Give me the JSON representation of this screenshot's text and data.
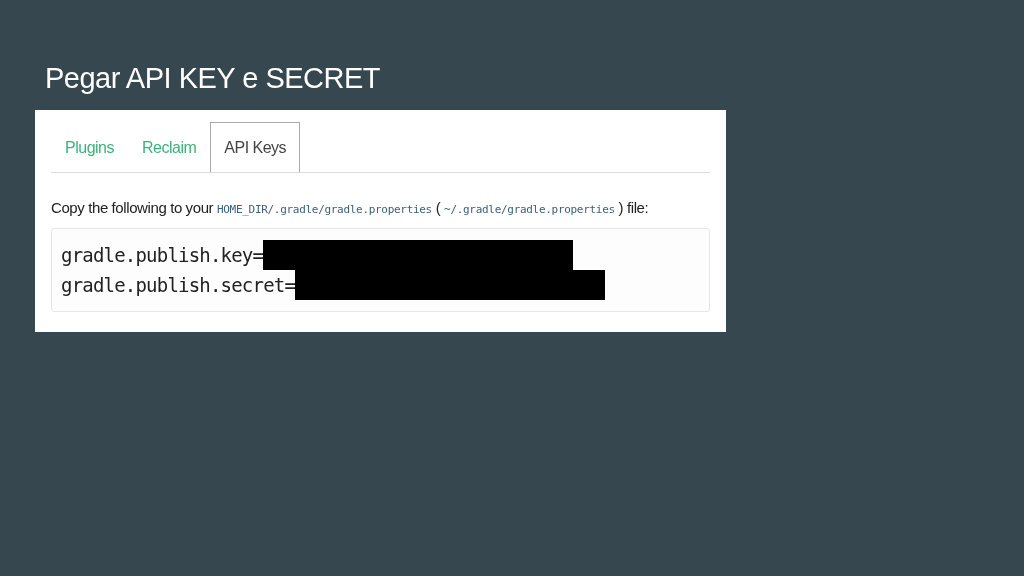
{
  "slide": {
    "title": "Pegar API KEY e SECRET"
  },
  "tabs": [
    {
      "label": "Plugins",
      "selected": false
    },
    {
      "label": "Reclaim",
      "selected": false
    },
    {
      "label": "API Keys",
      "selected": true
    }
  ],
  "instruction": [
    {
      "kind": "text",
      "text": "Copy the following to your "
    },
    {
      "kind": "code",
      "text": "HOME_DIR/.gradle/gradle.properties"
    },
    {
      "kind": "text",
      "text": " ( "
    },
    {
      "kind": "code",
      "text": "~/.gradle/gradle.properties"
    },
    {
      "kind": "text",
      "text": " ) file:"
    }
  ],
  "code_lines": [
    {
      "text": "gradle.publish.key=",
      "redacted": true
    },
    {
      "text": "gradle.publish.secret=",
      "redacted": true
    }
  ]
}
